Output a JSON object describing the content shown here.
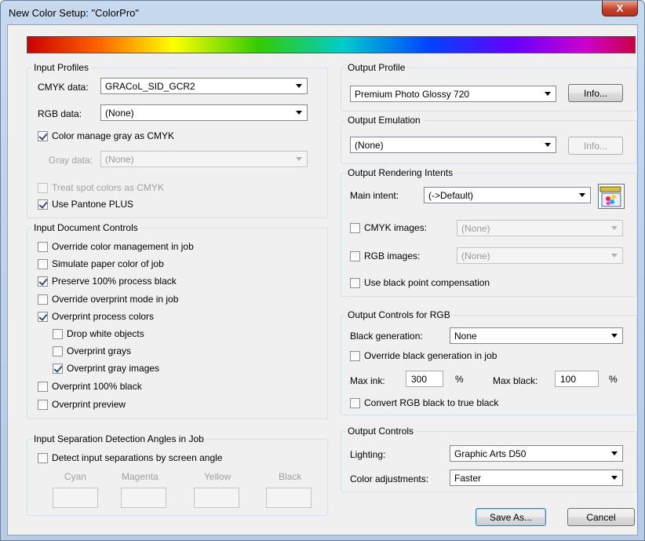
{
  "window": {
    "title": "New Color Setup: \"ColorPro\"",
    "close_label": "X"
  },
  "colors": {
    "accent": "#3c7fb1",
    "close": "#c7422b"
  },
  "input_profiles": {
    "label": "Input Profiles",
    "cmyk_label": "CMYK data:",
    "cmyk_value": "GRACoL_SID_GCR2",
    "rgb_label": "RGB data:",
    "rgb_value": "(None)",
    "gray_cmyk_label": "Color manage gray as CMYK",
    "gray_cmyk_checked": true,
    "gray_label": "Gray data:",
    "gray_value": "(None)",
    "spot_label": "Treat spot colors as CMYK",
    "spot_checked": false,
    "pantone_label": "Use Pantone PLUS",
    "pantone_checked": true
  },
  "input_doc": {
    "label": "Input Document Controls",
    "items": [
      {
        "label": "Override color management in job",
        "checked": false
      },
      {
        "label": "Simulate paper color of job",
        "checked": false
      },
      {
        "label": "Preserve 100% process black",
        "checked": true
      },
      {
        "label": "Override overprint mode in job",
        "checked": false
      },
      {
        "label": "Overprint process colors",
        "checked": true
      },
      {
        "label": "Drop white objects",
        "checked": false
      },
      {
        "label": "Overprint grays",
        "checked": false
      },
      {
        "label": "Overprint gray images",
        "checked": true
      },
      {
        "label": "Overprint 100% black",
        "checked": false
      },
      {
        "label": "Overprint preview",
        "checked": false
      }
    ]
  },
  "separation": {
    "label": "Input Separation Detection Angles in Job",
    "detect_label": "Detect input separations by screen angle",
    "detect_checked": false,
    "cyan": "Cyan",
    "magenta": "Magenta",
    "yellow": "Yellow",
    "black": "Black"
  },
  "output_profile": {
    "label": "Output Profile",
    "value": "Premium Photo Glossy 720",
    "info": "Info..."
  },
  "output_emulation": {
    "label": "Output Emulation",
    "value": "(None)",
    "info": "Info..."
  },
  "rendering": {
    "label": "Output Rendering Intents",
    "main_label": "Main intent:",
    "main_value": "(->Default)",
    "cmyk_label": "CMYK images:",
    "cmyk_value": "(None)",
    "rgb_label": "RGB images:",
    "rgb_value": "(None)",
    "bpc_label": "Use black point compensation"
  },
  "rgb_controls": {
    "label": "Output Controls for RGB",
    "bg_label": "Black generation:",
    "bg_value": "None",
    "override_label": "Override black generation in job",
    "maxink_label": "Max ink:",
    "maxink_value": "300",
    "pct1": "%",
    "maxblack_label": "Max black:",
    "maxblack_value": "100",
    "pct2": "%",
    "convert_label": "Convert RGB black to true black"
  },
  "output_controls": {
    "label": "Output Controls",
    "lighting_label": "Lighting:",
    "lighting_value": "Graphic Arts D50",
    "adjust_label": "Color adjustments:",
    "adjust_value": "Faster"
  },
  "buttons": {
    "save_as": "Save As...",
    "cancel": "Cancel"
  }
}
